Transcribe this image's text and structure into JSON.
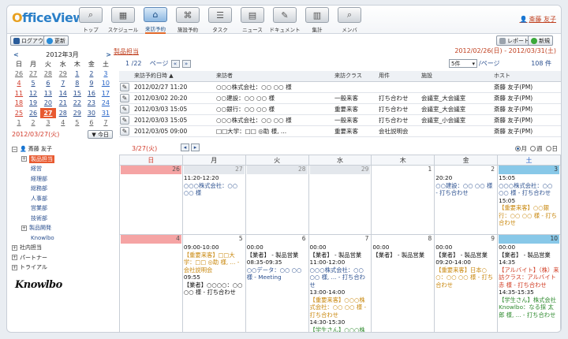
{
  "app": {
    "logo": "OfficeView",
    "user": "斎藤 友子"
  },
  "nav": [
    {
      "label": "トップ",
      "icon": "search-icon",
      "glyph": "⌕"
    },
    {
      "label": "スケジュール",
      "icon": "calendar-icon",
      "glyph": "▦"
    },
    {
      "label": "来訪予約",
      "icon": "visitor-icon",
      "glyph": "⌂"
    },
    {
      "label": "施設予約",
      "icon": "facility-icon",
      "glyph": "⌘"
    },
    {
      "label": "タスク",
      "icon": "task-icon",
      "glyph": "☰"
    },
    {
      "label": "ニュース",
      "icon": "news-icon",
      "glyph": "▤"
    },
    {
      "label": "ドキュメント",
      "icon": "document-icon",
      "glyph": "✎"
    },
    {
      "label": "集計",
      "icon": "chart-icon",
      "glyph": "▥"
    },
    {
      "label": "メンバ",
      "icon": "member-icon",
      "glyph": "⌕"
    }
  ],
  "toolbar": {
    "logout": "ログアウト",
    "refresh": "更新",
    "report": "レポート",
    "new": "新規"
  },
  "mini_cal": {
    "month": "2012年3月",
    "weekdays": [
      "日",
      "月",
      "火",
      "水",
      "木",
      "金",
      "土"
    ],
    "weeks": [
      [
        "26",
        "27",
        "28",
        "29",
        "1",
        "2",
        "3"
      ],
      [
        "4",
        "5",
        "6",
        "7",
        "8",
        "9",
        "10"
      ],
      [
        "11",
        "12",
        "13",
        "14",
        "15",
        "16",
        "17"
      ],
      [
        "18",
        "19",
        "20",
        "21",
        "22",
        "23",
        "24"
      ],
      [
        "25",
        "26",
        "27",
        "28",
        "29",
        "30",
        "31"
      ],
      [
        "1",
        "2",
        "3",
        "4",
        "5",
        "6",
        "7"
      ]
    ],
    "selected_date": "2012/03/27(火)",
    "today_btn": "今日"
  },
  "tree": [
    {
      "label": "斎藤 友子",
      "level": 0,
      "toggle": "⊟"
    },
    {
      "label": "製品担当",
      "level": 1,
      "toggle": "⊞",
      "highlight": true
    },
    {
      "label": "経営",
      "level": 2
    },
    {
      "label": "経理部",
      "level": 2
    },
    {
      "label": "総務部",
      "level": 2
    },
    {
      "label": "人事部",
      "level": 2
    },
    {
      "label": "営業部",
      "level": 2
    },
    {
      "label": "技術部",
      "level": 2
    },
    {
      "label": "製品開発",
      "level": 1,
      "toggle": "⊞"
    },
    {
      "label": "Knowlbo",
      "level": 2
    },
    {
      "label": "社内担当",
      "level": 0,
      "toggle": "⊞"
    },
    {
      "label": "パートナー",
      "level": 0,
      "toggle": "⊞"
    },
    {
      "label": "トライアル",
      "level": 0,
      "toggle": "⊞"
    }
  ],
  "bottom_logo": "Knowlbo",
  "group_label": "製品担当",
  "date_range": "2012/02/26(日) - 2012/03/31(土)",
  "pager": {
    "page": "1 /22",
    "label": "ページ",
    "per_page": "5件",
    "per_page_suffix": "/ページ",
    "total": "108 件"
  },
  "visits": {
    "headers": [
      "来訪予約日時 ▲",
      "来訪者",
      "来訪クラス",
      "用件",
      "施設",
      "ホスト"
    ],
    "rows": [
      [
        "2012/02/27 11:20",
        "○○○株式会社：○○ ○○ 様",
        "",
        "",
        "",
        "斎藤 友子(PM)"
      ],
      [
        "2012/03/02 20:20",
        "○○建設：○○ ○○ 様",
        "一般来客",
        "打ち合わせ",
        "会議室_大会議室",
        "斎藤 友子(PM)"
      ],
      [
        "2012/03/03 15:05",
        "○○銀行：○○ ○○ 様",
        "重要来客",
        "打ち合わせ",
        "会議室_大会議室",
        "斎藤 友子(PM)"
      ],
      [
        "2012/03/03 15:05",
        "○○○株式会社：○○ ○○ 様",
        "一般来客",
        "打ち合わせ",
        "会議室_小会議室",
        "斎藤 友子(PM)"
      ],
      [
        "2012/03/05 09:00",
        "□□大学：□□ ◎助 様, ...",
        "重要来客",
        "会社説明会",
        "",
        "斎藤 友子(PM)"
      ]
    ]
  },
  "week": {
    "date": "3/27(火)",
    "views": [
      "月",
      "週",
      "日"
    ],
    "headers": [
      "日",
      "月",
      "火",
      "水",
      "木",
      "金",
      "土"
    ]
  },
  "month_grid": [
    [
      {
        "day": "26",
        "style": "hol",
        "events": []
      },
      {
        "day": "27",
        "style": "past",
        "events": [
          {
            "text": "11:20-12:20",
            "color": "black"
          },
          {
            "text": "○○○株式会社：○○ ○○ 様",
            "color": "blue",
            "link": true
          }
        ]
      },
      {
        "day": "28",
        "style": "past",
        "events": []
      },
      {
        "day": "29",
        "style": "past",
        "events": []
      },
      {
        "day": "1",
        "style": "",
        "events": []
      },
      {
        "day": "2",
        "style": "",
        "events": [
          {
            "text": "20:20",
            "color": "black"
          },
          {
            "text": "○○建設：○○ ○○ 様 - 打ち合わせ",
            "color": "blue",
            "link": true
          }
        ]
      },
      {
        "day": "3",
        "style": "satc",
        "events": [
          {
            "text": "15:05",
            "color": "black"
          },
          {
            "text": "○○○株式会社：○○ ○○ 様 - 打ち合わせ",
            "color": "blue",
            "link": true
          },
          {
            "text": "15:05",
            "color": "black"
          },
          {
            "text": "【重要来客】○○銀行：○○ ○○ 様 - 打ち合わせ",
            "color": "orange",
            "link": true
          }
        ]
      }
    ],
    [
      {
        "day": "4",
        "style": "hol",
        "events": []
      },
      {
        "day": "5",
        "style": "",
        "events": [
          {
            "text": "09:00-10:00",
            "color": "black"
          },
          {
            "text": "【重要来客】□□大学：□□ ◎助 様, ... - 会社説明会",
            "color": "orange",
            "link": true
          },
          {
            "text": "09:55",
            "color": "black"
          },
          {
            "text": "【業者】○○○○：○○ ○○ 様 - 打ち合わせ",
            "color": "black",
            "link": true
          }
        ]
      },
      {
        "day": "6",
        "style": "",
        "events": [
          {
            "text": "00:00",
            "color": "black"
          },
          {
            "text": "【業者】 - 製品営業",
            "color": "black",
            "link": true
          },
          {
            "text": "08:35-09:35",
            "color": "black"
          },
          {
            "text": "○○データ：○○ ○○ 様 - Meeting",
            "color": "blue",
            "link": true
          }
        ]
      },
      {
        "day": "7",
        "style": "",
        "events": [
          {
            "text": "00:00",
            "color": "black"
          },
          {
            "text": "【業者】 - 製品営業",
            "color": "black",
            "link": true
          },
          {
            "text": "11:00-12:00",
            "color": "black"
          },
          {
            "text": "○○○株式会社：○○ ○○ 様, ... - 打ち合わせ",
            "color": "blue",
            "link": true
          },
          {
            "text": "13:00-14:00",
            "color": "black"
          },
          {
            "text": "【重要来客】○○○株式会社：○○ ○○ 様 - 打ち合わせ",
            "color": "orange",
            "link": true
          },
          {
            "text": "14:30-15:30",
            "color": "black"
          },
          {
            "text": "【学生さん】○○○株",
            "color": "green",
            "link": true
          }
        ]
      },
      {
        "day": "8",
        "style": "",
        "events": [
          {
            "text": "00:00",
            "color": "black"
          },
          {
            "text": "【業者】 - 製品営業",
            "color": "black",
            "link": true
          }
        ]
      },
      {
        "day": "9",
        "style": "",
        "events": [
          {
            "text": "00:00",
            "color": "black"
          },
          {
            "text": "【業者】 - 製品営業",
            "color": "black",
            "link": true
          },
          {
            "text": "09:20-14:00",
            "color": "black"
          },
          {
            "text": "【重要来客】日本○○：○○ ○○ 様 - 打ち合わせ",
            "color": "orange",
            "link": true
          }
        ]
      },
      {
        "day": "10",
        "style": "satc",
        "events": [
          {
            "text": "00:00",
            "color": "black"
          },
          {
            "text": "【業者】 - 製品営業",
            "color": "black",
            "link": true
          },
          {
            "text": "14:35",
            "color": "black"
          },
          {
            "text": "【アルバイト】（株）来訪クラス：アルバイト 赤 様 - 打ち合わせ",
            "color": "red",
            "link": true
          },
          {
            "text": "14:35-15:35",
            "color": "black"
          },
          {
            "text": "【学生さん】株式会社Knowlbo：なる採 太郎 様, ... - 打ち合わせ",
            "color": "green",
            "link": true
          }
        ]
      }
    ]
  ]
}
